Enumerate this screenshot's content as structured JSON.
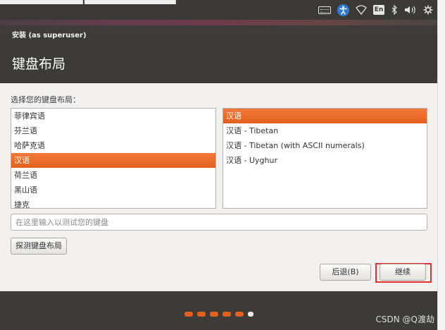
{
  "panel": {
    "tray": [
      {
        "name": "keyboard-icon"
      },
      {
        "name": "accessibility-icon"
      },
      {
        "name": "wifi-icon"
      },
      {
        "name": "language-indicator",
        "label": "En"
      },
      {
        "name": "bluetooth-icon"
      },
      {
        "name": "volume-icon"
      },
      {
        "name": "system-gear-icon"
      }
    ]
  },
  "header": {
    "window_title": "安装 (as superuser)",
    "page_title": "键盘布局"
  },
  "main": {
    "prompt": "选择您的键盘布局：",
    "layouts": [
      "菲律宾语",
      "芬兰语",
      "哈萨克语",
      "汉语",
      "荷兰语",
      "黑山语",
      "捷克"
    ],
    "selected_layout_index": 3,
    "variants": [
      "汉语",
      "汉语 - Tibetan",
      "汉语 - Tibetan (with ASCII numerals)",
      "汉语 - Uyghur"
    ],
    "selected_variant_index": 0,
    "test_input_placeholder": "在这里输入以测试您的键盘",
    "test_input_value": "",
    "detect_button": "探测键盘布局"
  },
  "nav": {
    "back_button": "后退(B)",
    "continue_button": "继续"
  },
  "footer": {
    "progress_steps_total": 6,
    "progress_current_step": 6,
    "watermark": "CSDN @Q渡劫"
  },
  "colors": {
    "accent": "#e2601b",
    "header_bg": "#3c3b37",
    "highlight_box": "#e03030"
  }
}
